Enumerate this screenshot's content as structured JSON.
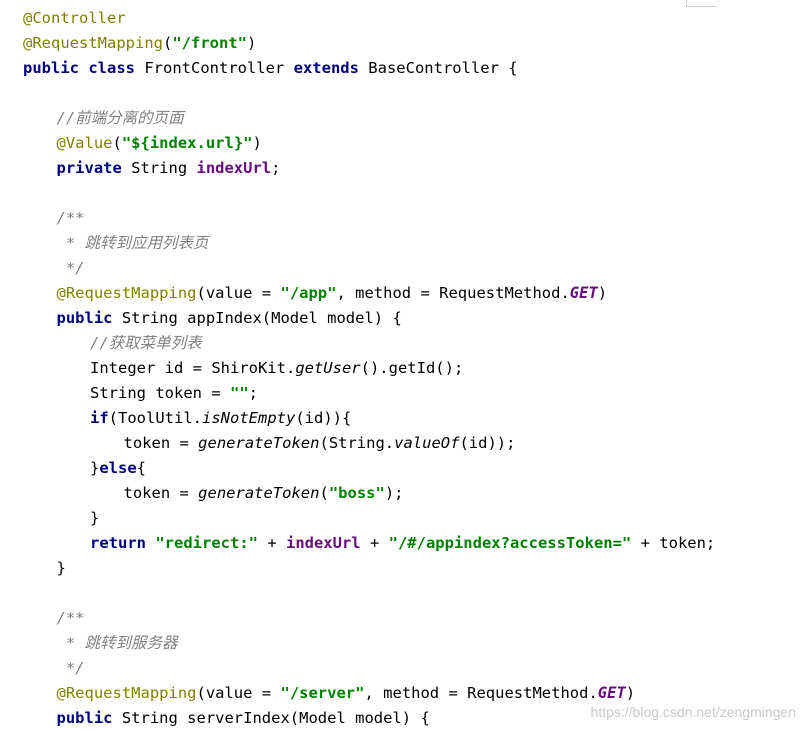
{
  "code_lines": [
    {
      "indent": 0,
      "tokens": [
        {
          "t": "@Controller",
          "c": "ann"
        }
      ]
    },
    {
      "indent": 0,
      "tokens": [
        {
          "t": "@RequestMapping",
          "c": "ann"
        },
        {
          "t": "(",
          "c": "plain"
        },
        {
          "t": "\"/front\"",
          "c": "str"
        },
        {
          "t": ")",
          "c": "plain"
        }
      ]
    },
    {
      "indent": 0,
      "tokens": [
        {
          "t": "public class ",
          "c": "kw"
        },
        {
          "t": "FrontController ",
          "c": "plain"
        },
        {
          "t": "extends ",
          "c": "kw"
        },
        {
          "t": "BaseController {",
          "c": "plain"
        }
      ]
    },
    {
      "indent": 0,
      "tokens": []
    },
    {
      "indent": 1,
      "tokens": [
        {
          "t": "//前端分离的页面",
          "c": "cmt"
        }
      ]
    },
    {
      "indent": 1,
      "tokens": [
        {
          "t": "@Value",
          "c": "ann"
        },
        {
          "t": "(",
          "c": "plain"
        },
        {
          "t": "\"${index.url}\"",
          "c": "str"
        },
        {
          "t": ")",
          "c": "plain"
        }
      ]
    },
    {
      "indent": 1,
      "tokens": [
        {
          "t": "private ",
          "c": "kw"
        },
        {
          "t": "String ",
          "c": "plain"
        },
        {
          "t": "indexUrl",
          "c": "fld"
        },
        {
          "t": ";",
          "c": "plain"
        }
      ]
    },
    {
      "indent": 0,
      "tokens": []
    },
    {
      "indent": 1,
      "tokens": [
        {
          "t": "/**",
          "c": "cmt"
        }
      ]
    },
    {
      "indent": 1,
      "tokens": [
        {
          "t": " * 跳转到应用列表页",
          "c": "cmt"
        }
      ]
    },
    {
      "indent": 1,
      "tokens": [
        {
          "t": " */",
          "c": "cmt"
        }
      ]
    },
    {
      "indent": 1,
      "tokens": [
        {
          "t": "@RequestMapping",
          "c": "ann"
        },
        {
          "t": "(value = ",
          "c": "plain"
        },
        {
          "t": "\"/app\"",
          "c": "str"
        },
        {
          "t": ", method = RequestMethod.",
          "c": "plain"
        },
        {
          "t": "GET",
          "c": "sfld"
        },
        {
          "t": ")",
          "c": "plain"
        }
      ]
    },
    {
      "indent": 1,
      "tokens": [
        {
          "t": "public ",
          "c": "kw"
        },
        {
          "t": "String appIndex(Model model) {",
          "c": "plain"
        }
      ]
    },
    {
      "indent": 2,
      "tokens": [
        {
          "t": "//获取菜单列表",
          "c": "cmt"
        }
      ]
    },
    {
      "indent": 2,
      "tokens": [
        {
          "t": "Integer id = ShiroKit.",
          "c": "plain"
        },
        {
          "t": "getUser",
          "c": "it"
        },
        {
          "t": "().getId();",
          "c": "plain"
        }
      ]
    },
    {
      "indent": 2,
      "tokens": [
        {
          "t": "String token = ",
          "c": "plain"
        },
        {
          "t": "\"\"",
          "c": "str"
        },
        {
          "t": ";",
          "c": "plain"
        }
      ]
    },
    {
      "indent": 2,
      "tokens": [
        {
          "t": "if",
          "c": "kw"
        },
        {
          "t": "(ToolUtil.",
          "c": "plain"
        },
        {
          "t": "isNotEmpty",
          "c": "it"
        },
        {
          "t": "(id)){",
          "c": "plain"
        }
      ]
    },
    {
      "indent": 3,
      "tokens": [
        {
          "t": "token = ",
          "c": "plain"
        },
        {
          "t": "generateToken",
          "c": "it"
        },
        {
          "t": "(String.",
          "c": "plain"
        },
        {
          "t": "valueOf",
          "c": "it"
        },
        {
          "t": "(id));",
          "c": "plain"
        }
      ]
    },
    {
      "indent": 2,
      "tokens": [
        {
          "t": "}",
          "c": "plain"
        },
        {
          "t": "else",
          "c": "kw"
        },
        {
          "t": "{",
          "c": "plain"
        }
      ]
    },
    {
      "indent": 3,
      "tokens": [
        {
          "t": "token = ",
          "c": "plain"
        },
        {
          "t": "generateToken",
          "c": "it"
        },
        {
          "t": "(",
          "c": "plain"
        },
        {
          "t": "\"boss\"",
          "c": "str"
        },
        {
          "t": ");",
          "c": "plain"
        }
      ]
    },
    {
      "indent": 2,
      "tokens": [
        {
          "t": "}",
          "c": "plain"
        }
      ]
    },
    {
      "indent": 2,
      "tokens": [
        {
          "t": "return ",
          "c": "kw"
        },
        {
          "t": "\"redirect:\"",
          "c": "str"
        },
        {
          "t": " + ",
          "c": "plain"
        },
        {
          "t": "indexUrl",
          "c": "fld"
        },
        {
          "t": " + ",
          "c": "plain"
        },
        {
          "t": "\"/#/appindex?accessToken=\"",
          "c": "str"
        },
        {
          "t": " + token;",
          "c": "plain"
        }
      ]
    },
    {
      "indent": 1,
      "tokens": [
        {
          "t": "}",
          "c": "plain"
        }
      ]
    },
    {
      "indent": 0,
      "tokens": []
    },
    {
      "indent": 1,
      "tokens": [
        {
          "t": "/**",
          "c": "cmt"
        }
      ]
    },
    {
      "indent": 1,
      "tokens": [
        {
          "t": " * 跳转到服务器",
          "c": "cmt"
        }
      ]
    },
    {
      "indent": 1,
      "tokens": [
        {
          "t": " */",
          "c": "cmt"
        }
      ]
    },
    {
      "indent": 1,
      "tokens": [
        {
          "t": "@RequestMapping",
          "c": "ann"
        },
        {
          "t": "(value = ",
          "c": "plain"
        },
        {
          "t": "\"/server\"",
          "c": "str"
        },
        {
          "t": ", method = RequestMethod.",
          "c": "plain"
        },
        {
          "t": "GET",
          "c": "sfld"
        },
        {
          "t": ")",
          "c": "plain"
        }
      ]
    },
    {
      "indent": 1,
      "tokens": [
        {
          "t": "public ",
          "c": "kw"
        },
        {
          "t": "String serverIndex(Model model) {",
          "c": "plain"
        }
      ]
    }
  ],
  "watermark": "https://blog.csdn.net/zengmingen",
  "colors": {
    "annotation": "#808000",
    "keyword": "#000080",
    "string": "#008000",
    "field": "#660e7a",
    "comment": "#808080",
    "background": "#ffffff"
  }
}
